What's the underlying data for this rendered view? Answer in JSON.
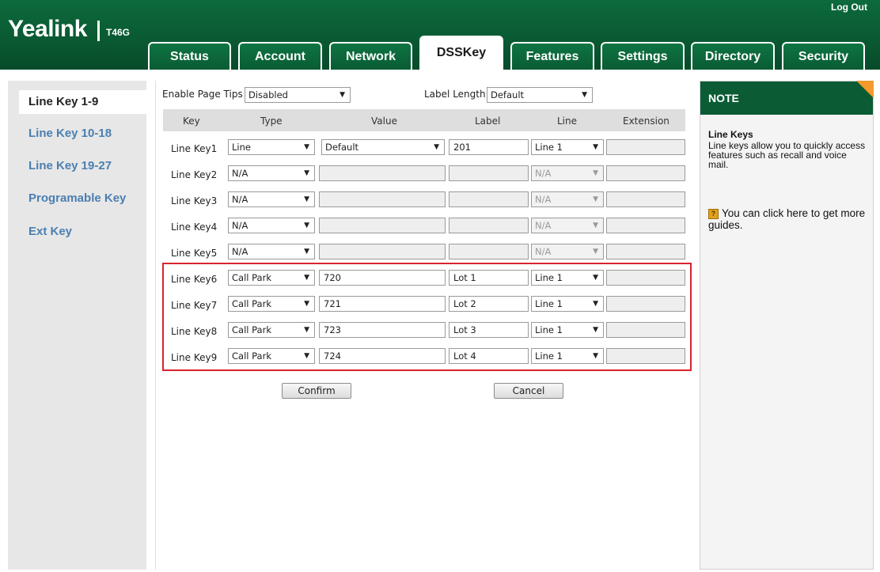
{
  "header": {
    "brand": "Yealink",
    "model": "T46G",
    "logout": "Log Out",
    "tabs": [
      {
        "label": "Status"
      },
      {
        "label": "Account"
      },
      {
        "label": "Network"
      },
      {
        "label": "DSSKey"
      },
      {
        "label": "Features"
      },
      {
        "label": "Settings"
      },
      {
        "label": "Directory"
      },
      {
        "label": "Security"
      }
    ]
  },
  "sidebar": {
    "items": [
      {
        "label": "Line Key 1-9"
      },
      {
        "label": "Line Key 10-18"
      },
      {
        "label": "Line Key 19-27"
      },
      {
        "label": "Programable Key"
      },
      {
        "label": "Ext Key"
      }
    ]
  },
  "main": {
    "page_tips_label": "Enable Page Tips",
    "page_tips_value": "Disabled",
    "label_length_label": "Label Length",
    "label_length_value": "Default",
    "columns": [
      "Key",
      "Type",
      "Value",
      "Label",
      "Line",
      "Extension"
    ],
    "rows": [
      {
        "key": "Line Key1",
        "type": "Line",
        "value": "Default",
        "label": "201",
        "line": "Line 1",
        "extension": ""
      },
      {
        "key": "Line Key2",
        "type": "N/A",
        "value": "",
        "label": "",
        "line": "N/A",
        "extension": ""
      },
      {
        "key": "Line Key3",
        "type": "N/A",
        "value": "",
        "label": "",
        "line": "N/A",
        "extension": ""
      },
      {
        "key": "Line Key4",
        "type": "N/A",
        "value": "",
        "label": "",
        "line": "N/A",
        "extension": ""
      },
      {
        "key": "Line Key5",
        "type": "N/A",
        "value": "",
        "label": "",
        "line": "N/A",
        "extension": ""
      },
      {
        "key": "Line Key6",
        "type": "Call Park",
        "value": "720",
        "label": "Lot 1",
        "line": "Line 1",
        "extension": ""
      },
      {
        "key": "Line Key7",
        "type": "Call Park",
        "value": "721",
        "label": "Lot 2",
        "line": "Line 1",
        "extension": ""
      },
      {
        "key": "Line Key8",
        "type": "Call Park",
        "value": "723",
        "label": "Lot 3",
        "line": "Line 1",
        "extension": ""
      },
      {
        "key": "Line Key9",
        "type": "Call Park",
        "value": "724",
        "label": "Lot 4",
        "line": "Line 1",
        "extension": ""
      }
    ],
    "confirm": "Confirm",
    "cancel": "Cancel"
  },
  "note": {
    "heading": "NOTE",
    "title": "Line Keys",
    "description": "Line keys allow you to quickly access features such as recall and voice mail.",
    "link": "You can click here to get more guides.",
    "help_icon_glyph": "?"
  },
  "colors": {
    "brand_green": "#0b5c35",
    "link_blue": "#4a7fb0",
    "highlight_red": "#d9232e",
    "note_corner_orange": "#f39a2b"
  },
  "icons": {
    "dropdown_arrow": "▼"
  }
}
